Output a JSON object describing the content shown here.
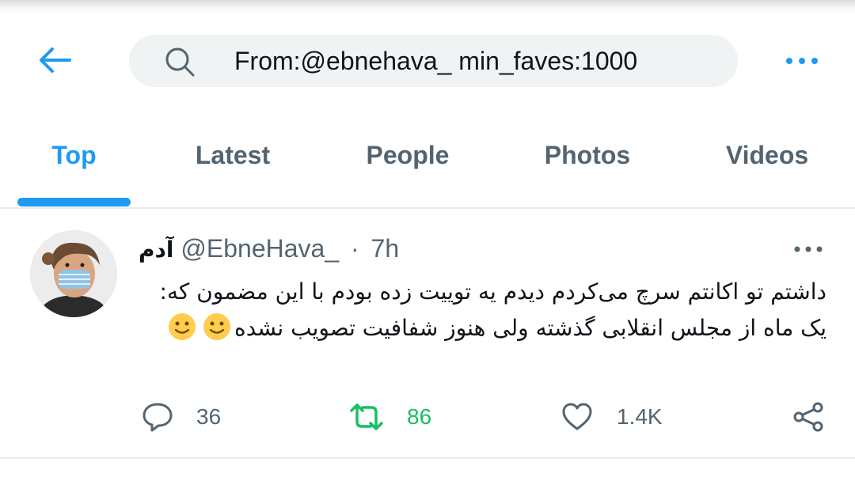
{
  "header": {
    "search_query": "From:@ebnehava_ min_faves:1000",
    "back_icon": "arrow-left-icon",
    "search_icon": "search-icon",
    "more_icon": "more-horizontal-icon"
  },
  "tabs": [
    {
      "label": "Top",
      "active": true
    },
    {
      "label": "Latest",
      "active": false
    },
    {
      "label": "People",
      "active": false
    },
    {
      "label": "Photos",
      "active": false
    },
    {
      "label": "Videos",
      "active": false
    }
  ],
  "tweet": {
    "display_name": "آدم",
    "handle": "@EbneHava_",
    "separator": "·",
    "time": "7h",
    "text": "داشتم تو اکانتم سرچ می‌کردم دیدم یه توییت زده بودم با این مضمون که: یک ماه از مجلس انقلابی گذشته ولی هنوز شفافیت تصویب نشده",
    "emojis": [
      "🙂",
      "🙂"
    ],
    "replies": "36",
    "retweets": "86",
    "likes": "1.4K"
  },
  "colors": {
    "accent": "#1d9bf0",
    "retweet": "#17bf63",
    "secondary_text": "#536471",
    "search_bg": "#eff3f4"
  }
}
